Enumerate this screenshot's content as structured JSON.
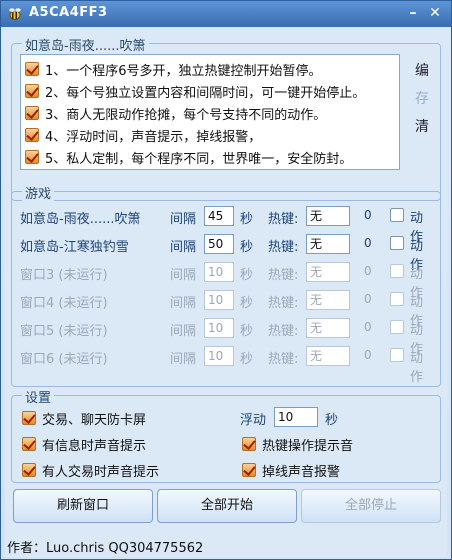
{
  "window": {
    "title": "A5CA4FF3"
  },
  "top_group": {
    "legend": "如意岛-雨夜......吹箫",
    "notes": [
      "1、一个程序6号多开，独立热键控制开始暂停。",
      "2、每个号独立设置内容和间隔时间，可一键开始停止。",
      "3、商人无限动作抢摊，每个号支持不同的动作。",
      "4、浮动时间，声音提示，掉线报警，",
      "5、私人定制，每个程序不同，世界唯一，安全防封。"
    ],
    "buttons": {
      "edit": "编",
      "save": "存",
      "clear": "清"
    }
  },
  "game_group": {
    "legend": "游戏",
    "interval_label": "间隔",
    "seconds_label": "秒",
    "hotkey_label": "热键:",
    "action_label": "动作",
    "rows": [
      {
        "name": "如意岛-雨夜......吹箫",
        "interval": "45",
        "hotkey": "无",
        "count": "0",
        "state": "active"
      },
      {
        "name": "如意岛-江寒独钓雪",
        "interval": "50",
        "hotkey": "无",
        "count": "0",
        "state": "active"
      },
      {
        "name": "窗口3 (未运行)",
        "interval": "10",
        "hotkey": "无",
        "count": "0",
        "state": "idle"
      },
      {
        "name": "窗口4 (未运行)",
        "interval": "10",
        "hotkey": "无",
        "count": "0",
        "state": "idle"
      },
      {
        "name": "窗口5 (未运行)",
        "interval": "10",
        "hotkey": "无",
        "count": "0",
        "state": "idle"
      },
      {
        "name": "窗口6 (未运行)",
        "interval": "10",
        "hotkey": "无",
        "count": "0",
        "state": "idle"
      }
    ]
  },
  "settings_group": {
    "legend": "设置",
    "anti_freeze": "交易、聊天防卡屏",
    "float_label": "浮动",
    "float_value": "10",
    "float_unit": "秒",
    "msg_sound": "有信息时声音提示",
    "hotkey_sound": "热键操作提示音",
    "trade_sound": "有人交易时声音提示",
    "disconnect_alarm": "掉线声音报警"
  },
  "actions": {
    "refresh": "刷新窗口",
    "start_all": "全部开始",
    "stop_all": "全部停止"
  },
  "status": {
    "author": "作者：Luo.chris   QQ304775562"
  }
}
